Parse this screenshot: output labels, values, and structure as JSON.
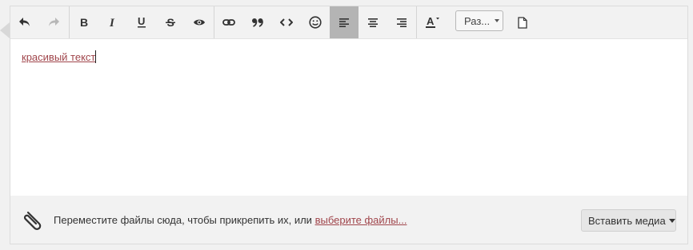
{
  "toolbar": {
    "undo_icon": "undo-icon",
    "redo_icon": "redo-icon",
    "bold_icon": "bold-icon",
    "italic_icon": "italic-icon",
    "underline_icon": "underline-icon",
    "strike_icon": "strikethrough-icon",
    "preview_icon": "eye-icon",
    "link_icon": "link-icon",
    "quote_icon": "quote-icon",
    "code_icon": "code-icon",
    "smiley_icon": "smiley-icon",
    "align_left_icon": "align-left-icon",
    "align_center_icon": "align-center-icon",
    "align_right_icon": "align-right-icon",
    "text_color_icon": "text-color-icon",
    "size_label": "Раз...",
    "page_icon": "page-icon"
  },
  "editor": {
    "content_text": "красивый текст"
  },
  "footer": {
    "hint_text": "Переместите файлы сюда, чтобы прикрепить их, или",
    "choose_files_link": "выберите файлы...",
    "insert_media_label": "Вставить медиа",
    "paperclip_icon": "paperclip-icon"
  },
  "colors": {
    "link": "#a0454b",
    "active_button": "#b4b4b4",
    "toolbar_bg": "#f2f2f2"
  }
}
